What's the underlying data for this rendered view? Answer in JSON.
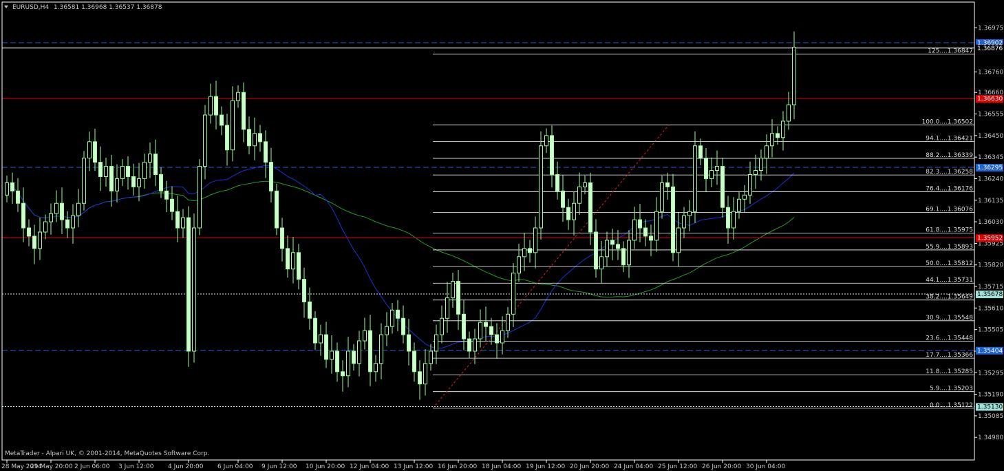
{
  "window": {
    "symbol_label": "EURUSD,H4",
    "ohlc": "1.36581 1.36968 1.36537 1.36878",
    "menu_icon": "triangle-down-icon"
  },
  "footer": {
    "copyright": "MetaTrader - Alpari UK, © 2001-2014, MetaQuotes Software Corp."
  },
  "colors": {
    "background": "#000000",
    "grid": "#ffffff",
    "candle_bull": "#000000",
    "candle_bear": "#ccffcc",
    "candle_outline": "#99ff99",
    "ma_slow": "#1f9e1f",
    "ma_fast": "#1e2fd6",
    "hline_red": "#e00000",
    "hline_blue": "#1e63d6",
    "fib_line": "#ffffff",
    "fib_trend": "#e02020",
    "tag_blue_bg": "#1e63d6",
    "tag_red_bg": "#e00000",
    "tag_teal_bg": "#a0e0d8"
  },
  "chart_data": {
    "type": "candlestick",
    "symbol": "EURUSD",
    "timeframe": "H4",
    "ylim": [
      1.3487,
      1.371
    ],
    "grid": false,
    "y_ticks": [
      "1.36975",
      "1.36760",
      "1.36660",
      "1.36555",
      "1.36450",
      "1.36345",
      "1.36240",
      "1.36135",
      "1.36030",
      "1.35925",
      "1.35820",
      "1.35715",
      "1.35610",
      "1.35505",
      "1.35400",
      "1.35295",
      "1.35190",
      "1.35085",
      "1.34980"
    ],
    "y_tick_values": [
      1.36975,
      1.3676,
      1.3666,
      1.36555,
      1.3645,
      1.36345,
      1.3624,
      1.36135,
      1.3603,
      1.35925,
      1.3582,
      1.35715,
      1.3561,
      1.35505,
      1.354,
      1.35295,
      1.3519,
      1.35085,
      1.3498
    ],
    "x_labels": [
      "28 May 2014",
      "29 May 20:00",
      "2 Jun 06:00",
      "3 Jun 12:00",
      "4 Jun 20:00",
      "6 Jun 04:00",
      "9 Jun 12:00",
      "10 Jun 20:00",
      "12 Jun 04:00",
      "13 Jun 12:00",
      "16 Jun 20:00",
      "18 Jun 04:00",
      "19 Jun 12:00",
      "20 Jun 20:00",
      "24 Jun 04:00",
      "25 Jun 12:00",
      "26 Jun 20:00",
      "30 Jun 04:00"
    ],
    "x_label_index": [
      0,
      8,
      16,
      24,
      33,
      42,
      50,
      58,
      66,
      74,
      82,
      90,
      98,
      106,
      114,
      122,
      130,
      138
    ],
    "price_levels": [
      {
        "value": 1.36902,
        "label": "1.36902",
        "style": "dashed",
        "color": "blue"
      },
      {
        "value": 1.36876,
        "label": "1.36876",
        "style": "solid",
        "color": "white"
      },
      {
        "value": 1.3663,
        "label": "1.36630",
        "style": "solid",
        "color": "red"
      },
      {
        "value": 1.36295,
        "label": "1.36295",
        "style": "dashed",
        "color": "blue"
      },
      {
        "value": 1.35952,
        "label": "1.35952",
        "style": "solid",
        "color": "red"
      },
      {
        "value": 1.35678,
        "label": "1.35678",
        "style": "dotted",
        "color": "teal"
      },
      {
        "value": 1.35404,
        "label": "1.35404",
        "style": "dashed",
        "color": "blue"
      },
      {
        "value": 1.3513,
        "label": "1.35130",
        "style": "dotted",
        "color": "teal"
      }
    ],
    "fibonacci": {
      "low": 1.35122,
      "high": 1.36502,
      "start_index": 77,
      "end_index": 120,
      "levels": [
        {
          "label": "125....1.36847",
          "value": 1.36847
        },
        {
          "label": "100.0....1.36502",
          "value": 1.36502
        },
        {
          "label": "94.1....1.36421",
          "value": 1.36421
        },
        {
          "label": "88.2....1.36339",
          "value": 1.36339
        },
        {
          "label": "82.3....1.36258",
          "value": 1.36258
        },
        {
          "label": "76.4....1.36176",
          "value": 1.36176
        },
        {
          "label": "69.1....1.36076",
          "value": 1.36076
        },
        {
          "label": "61.8....1.35975",
          "value": 1.35975
        },
        {
          "label": "55.9....1.35893",
          "value": 1.35893
        },
        {
          "label": "50.0....1.35812",
          "value": 1.35812
        },
        {
          "label": "44.1....1.35731",
          "value": 1.35731
        },
        {
          "label": "38.2....1.35649",
          "value": 1.35649
        },
        {
          "label": "30.9....1.35548",
          "value": 1.35548
        },
        {
          "label": "23.6....1.35448",
          "value": 1.35448
        },
        {
          "label": "17.7....1.35366",
          "value": 1.35366
        },
        {
          "label": "11.8....1.35285",
          "value": 1.35285
        },
        {
          "label": "5.9....1.35203",
          "value": 1.35203
        },
        {
          "label": "0.0....1.35122",
          "value": 1.35122
        }
      ]
    },
    "closes": [
      1.3622,
      1.3618,
      1.3612,
      1.36,
      1.3596,
      1.359,
      1.3598,
      1.3603,
      1.3607,
      1.3612,
      1.3604,
      1.36,
      1.3606,
      1.3612,
      1.3634,
      1.3642,
      1.3632,
      1.3625,
      1.363,
      1.3618,
      1.3624,
      1.363,
      1.3625,
      1.362,
      1.3624,
      1.3632,
      1.3636,
      1.3626,
      1.3618,
      1.3614,
      1.3608,
      1.36,
      1.3605,
      1.354,
      1.36,
      1.363,
      1.3655,
      1.3664,
      1.3655,
      1.365,
      1.3638,
      1.3662,
      1.3666,
      1.3648,
      1.364,
      1.3646,
      1.3642,
      1.3632,
      1.3618,
      1.36,
      1.359,
      1.358,
      1.3588,
      1.3575,
      1.3564,
      1.3556,
      1.3544,
      1.3548,
      1.3536,
      1.354,
      1.353,
      1.3528,
      1.354,
      1.3534,
      1.3545,
      1.355,
      1.353,
      1.3534,
      1.3548,
      1.3552,
      1.356,
      1.3556,
      1.3548,
      1.354,
      1.353,
      1.3524,
      1.3534,
      1.354,
      1.3548,
      1.3556,
      1.3566,
      1.3574,
      1.3558,
      1.3546,
      1.354,
      1.3546,
      1.3554,
      1.3552,
      1.3548,
      1.3544,
      1.355,
      1.3558,
      1.3578,
      1.3586,
      1.359,
      1.3588,
      1.36,
      1.364,
      1.3645,
      1.3626,
      1.3618,
      1.361,
      1.3604,
      1.3612,
      1.362,
      1.3622,
      1.3598,
      1.358,
      1.3586,
      1.3594,
      1.3592,
      1.359,
      1.3582,
      1.3594,
      1.3604,
      1.36,
      1.3596,
      1.3594,
      1.3608,
      1.3622,
      1.362,
      1.3588,
      1.36,
      1.3606,
      1.3608,
      1.364,
      1.3634,
      1.3624,
      1.3628,
      1.363,
      1.361,
      1.36,
      1.3608,
      1.3614,
      1.3616,
      1.3626,
      1.3628,
      1.3634,
      1.364,
      1.3646,
      1.3644,
      1.3652,
      1.366,
      1.3688
    ]
  }
}
